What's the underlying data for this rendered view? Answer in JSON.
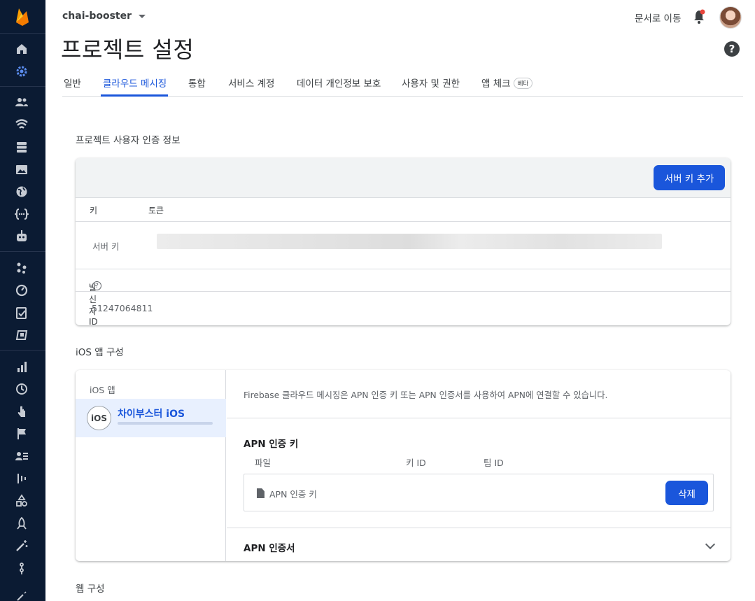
{
  "project": {
    "name": "chai-booster"
  },
  "header": {
    "docs_link": "문서로 이동",
    "page_title": "프로젝트 설정",
    "help": "?"
  },
  "tabs": [
    {
      "label": "일반",
      "active": false
    },
    {
      "label": "클라우드 메시징",
      "active": true
    },
    {
      "label": "통합",
      "active": false
    },
    {
      "label": "서비스 계정",
      "active": false
    },
    {
      "label": "데이터 개인정보 보호",
      "active": false
    },
    {
      "label": "사용자 및 권한",
      "active": false
    },
    {
      "label": "앱 체크",
      "active": false,
      "badge": "베타"
    }
  ],
  "credentials": {
    "section_title": "프로젝트 사용자 인증 정보",
    "add_server_key_label": "서버 키 추가",
    "col_key": "키",
    "col_token": "토큰",
    "server_key_label": "서버 키",
    "sender_id_label": "발신자 ID",
    "sender_id_value": "51247064811"
  },
  "ios_config": {
    "section_title": "iOS 앱 구성",
    "apps_title": "iOS 앱",
    "app": {
      "badge": "iOS",
      "name": "차이부스터 iOS"
    },
    "description": "Firebase 클라우드 메시징은 APN 인증 키 또는 APN 인증서를 사용하여 APN에 연결할 수 있습니다.",
    "apn_key_title": "APN 인증 키",
    "col_file": "파일",
    "col_key_id": "키 ID",
    "col_team_id": "팀 ID",
    "file_label": "APN 인증 키",
    "delete_label": "삭제",
    "apn_cert_title": "APN 인증서"
  },
  "web_config": {
    "section_title": "웹 구성"
  },
  "sidebar_icons": [
    "home-icon",
    "settings-icon",
    "users-icon",
    "wifi-icon",
    "database-icon",
    "image-icon",
    "globe-icon",
    "functions-icon",
    "robot-icon",
    "extensions-icon",
    "gauge-icon",
    "checklist-icon",
    "test-lab-icon",
    "bar-chart-icon",
    "clock-icon",
    "touch-icon",
    "flag-icon",
    "user-list-icon",
    "dot-plot-icon",
    "shapes-icon",
    "rocket-icon",
    "wand-icon",
    "git-icon"
  ],
  "colors": {
    "accent": "#1a56db",
    "sidebar": "#0b1b33",
    "active_tab": "#1a56db"
  }
}
